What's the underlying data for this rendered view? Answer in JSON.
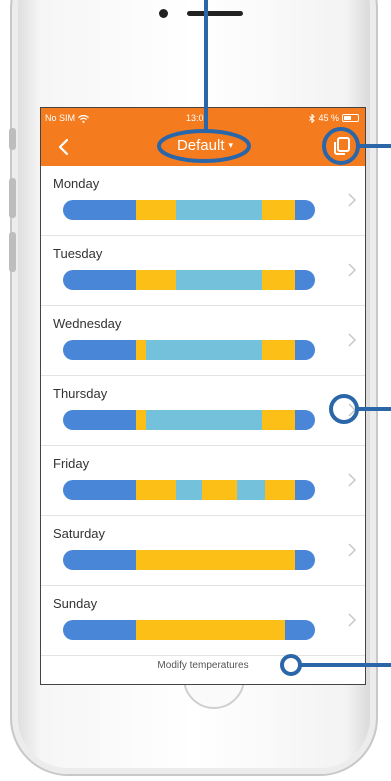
{
  "colors": {
    "header": "#f47c1f",
    "segment_blue": "#4a86d8",
    "segment_yellow": "#fbbf18",
    "segment_light": "#74c1db",
    "annotation": "#2b66a8"
  },
  "status": {
    "carrier": "No SIM",
    "wifi_icon": "wifi-icon",
    "time": "13:02",
    "bluetooth_icon": "bluetooth-icon",
    "battery": "45 %"
  },
  "header": {
    "back_icon": "chevron-left-icon",
    "title": "Default",
    "caret": "▾",
    "copy_icon": "copy-icon"
  },
  "days": [
    {
      "label": "Monday",
      "segments": [
        [
          "segment_blue",
          29
        ],
        [
          "segment_yellow",
          16
        ],
        [
          "segment_light",
          34
        ],
        [
          "segment_yellow",
          13
        ],
        [
          "segment_blue",
          8
        ]
      ]
    },
    {
      "label": "Tuesday",
      "segments": [
        [
          "segment_blue",
          29
        ],
        [
          "segment_yellow",
          16
        ],
        [
          "segment_light",
          34
        ],
        [
          "segment_yellow",
          13
        ],
        [
          "segment_blue",
          8
        ]
      ]
    },
    {
      "label": "Wednesday",
      "segments": [
        [
          "segment_blue",
          29
        ],
        [
          "segment_yellow",
          4
        ],
        [
          "segment_light",
          46
        ],
        [
          "segment_yellow",
          13
        ],
        [
          "segment_blue",
          8
        ]
      ]
    },
    {
      "label": "Thursday",
      "segments": [
        [
          "segment_blue",
          29
        ],
        [
          "segment_yellow",
          4
        ],
        [
          "segment_light",
          46
        ],
        [
          "segment_yellow",
          13
        ],
        [
          "segment_blue",
          8
        ]
      ]
    },
    {
      "label": "Friday",
      "segments": [
        [
          "segment_blue",
          29
        ],
        [
          "segment_yellow",
          16
        ],
        [
          "segment_light",
          10
        ],
        [
          "segment_yellow",
          14
        ],
        [
          "segment_light",
          11
        ],
        [
          "segment_yellow",
          12
        ],
        [
          "segment_blue",
          8
        ]
      ]
    },
    {
      "label": "Saturday",
      "segments": [
        [
          "segment_blue",
          29
        ],
        [
          "segment_yellow",
          63
        ],
        [
          "segment_blue",
          8
        ]
      ]
    },
    {
      "label": "Sunday",
      "segments": [
        [
          "segment_blue",
          29
        ],
        [
          "segment_yellow",
          59
        ],
        [
          "segment_blue",
          12
        ]
      ]
    }
  ],
  "footer": {
    "modify_label": "Modify temperatures"
  }
}
